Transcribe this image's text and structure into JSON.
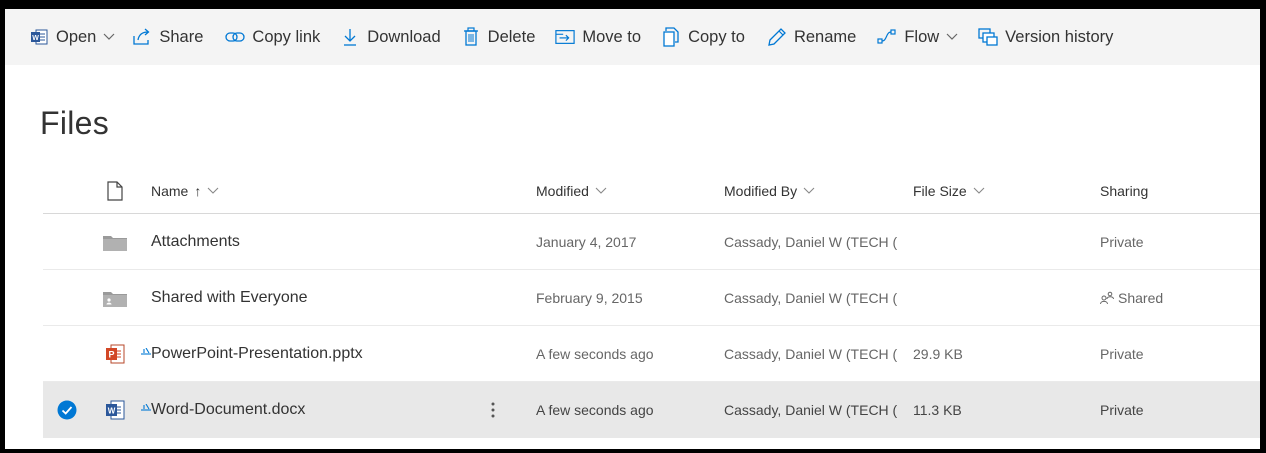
{
  "toolbar": {
    "open": "Open",
    "share": "Share",
    "copy_link": "Copy link",
    "download": "Download",
    "delete": "Delete",
    "move_to": "Move to",
    "copy_to": "Copy to",
    "rename": "Rename",
    "flow": "Flow",
    "version_history": "Version history"
  },
  "page": {
    "title": "Files"
  },
  "columns": {
    "name": "Name",
    "name_sort": "↑",
    "modified": "Modified",
    "modified_by": "Modified By",
    "file_size": "File Size",
    "sharing": "Sharing"
  },
  "rows": [
    {
      "name": "Attachments",
      "icon": "folder-icon",
      "modified": "January 4, 2017",
      "modified_by": "Cassady, Daniel W (TECH (",
      "size": "",
      "sharing": "Private",
      "selected": false
    },
    {
      "name": "Shared with Everyone",
      "icon": "shared-folder-icon",
      "modified": "February 9, 2015",
      "modified_by": "Cassady, Daniel W (TECH (",
      "size": "",
      "sharing": "Shared",
      "selected": false
    },
    {
      "name": "PowerPoint-Presentation.pptx",
      "icon": "powerpoint-file-icon",
      "modified": "A few seconds ago",
      "modified_by": "Cassady, Daniel W (TECH (",
      "size": "29.9 KB",
      "sharing": "Private",
      "selected": false
    },
    {
      "name": "Word-Document.docx",
      "icon": "word-file-icon",
      "modified": "A few seconds ago",
      "modified_by": "Cassady, Daniel W (TECH (",
      "size": "11.3 KB",
      "sharing": "Private",
      "selected": true
    }
  ],
  "colors": {
    "accent": "#0078d4",
    "word_blue": "#2b579a",
    "powerpoint_red": "#d24726",
    "command_bar_bg": "#f4f4f4",
    "selected_row_bg": "#e8e8e8"
  }
}
